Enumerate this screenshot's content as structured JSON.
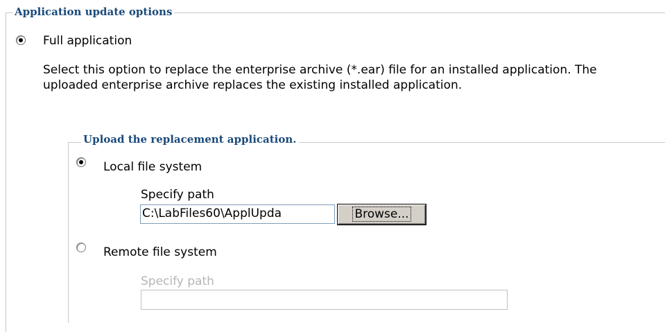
{
  "update_options": {
    "legend": "Application update options",
    "full_application": {
      "label": "Full application",
      "selected": true,
      "description": "Select this option to replace the enterprise archive (*.ear) file for an installed application. The uploaded enterprise archive replaces the existing installed application."
    },
    "upload_replacement": {
      "legend": "Upload the replacement application.",
      "local": {
        "label": "Local file system",
        "selected": true,
        "path_label": "Specify path",
        "path_value": "C:\\LabFiles60\\ApplUpda",
        "browse_label": "Browse..."
      },
      "remote": {
        "label": "Remote file system",
        "selected": false,
        "path_label": "Specify path",
        "path_value": ""
      }
    }
  }
}
